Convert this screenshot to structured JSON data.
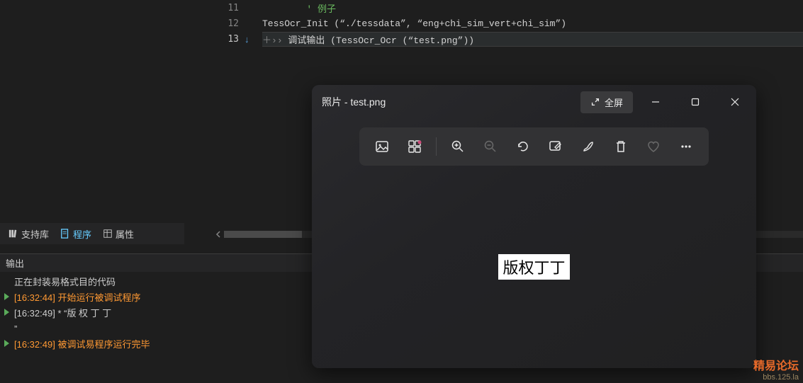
{
  "editor": {
    "lines": [
      {
        "num": "11",
        "comment": "' 例子"
      },
      {
        "num": "12",
        "func": "TessOcr_Init",
        "args_display": " (“./tessdata”, “eng+chi_sim_vert+chi_sim”)"
      },
      {
        "num": "13",
        "current": true,
        "func": "调试输出",
        "args_display": " (TessOcr_Ocr (“test.png”))"
      }
    ]
  },
  "panel_tabs": {
    "support": "支持库",
    "program": "程序",
    "props": "属性"
  },
  "output": {
    "title": "输出",
    "lines": [
      {
        "text": "正在封装易格式目的代码"
      },
      {
        "ts": "[16:32:44]",
        "text": " 开始运行被调试程序",
        "orange": true,
        "play": true
      },
      {
        "ts": "[16:32:49]",
        "text": " * “版 权 丁 丁",
        "play": true
      },
      {
        "text": "”"
      },
      {
        "ts": "[16:32:49]",
        "text": " 被调试易程序运行完毕",
        "orange": true,
        "play": true
      }
    ]
  },
  "photos": {
    "title": "照片 - test.png",
    "fullscreen": "全屏",
    "image_text": "版权丁丁"
  },
  "watermark": {
    "line1": "精易论坛",
    "line2": "bbs.125.la"
  },
  "icons": {
    "image": "image-icon",
    "filmstrip": "filmstrip-icon",
    "zoom_in": "zoom-in-icon",
    "zoom_out": "zoom-out-icon",
    "rotate": "rotate-icon",
    "edit_image": "edit-image-icon",
    "draw": "draw-icon",
    "trash": "trash-icon",
    "heart": "heart-icon",
    "more": "more-icon",
    "expand": "expand-icon",
    "minimize": "minimize-icon",
    "maximize": "maximize-icon",
    "close": "close-icon"
  }
}
